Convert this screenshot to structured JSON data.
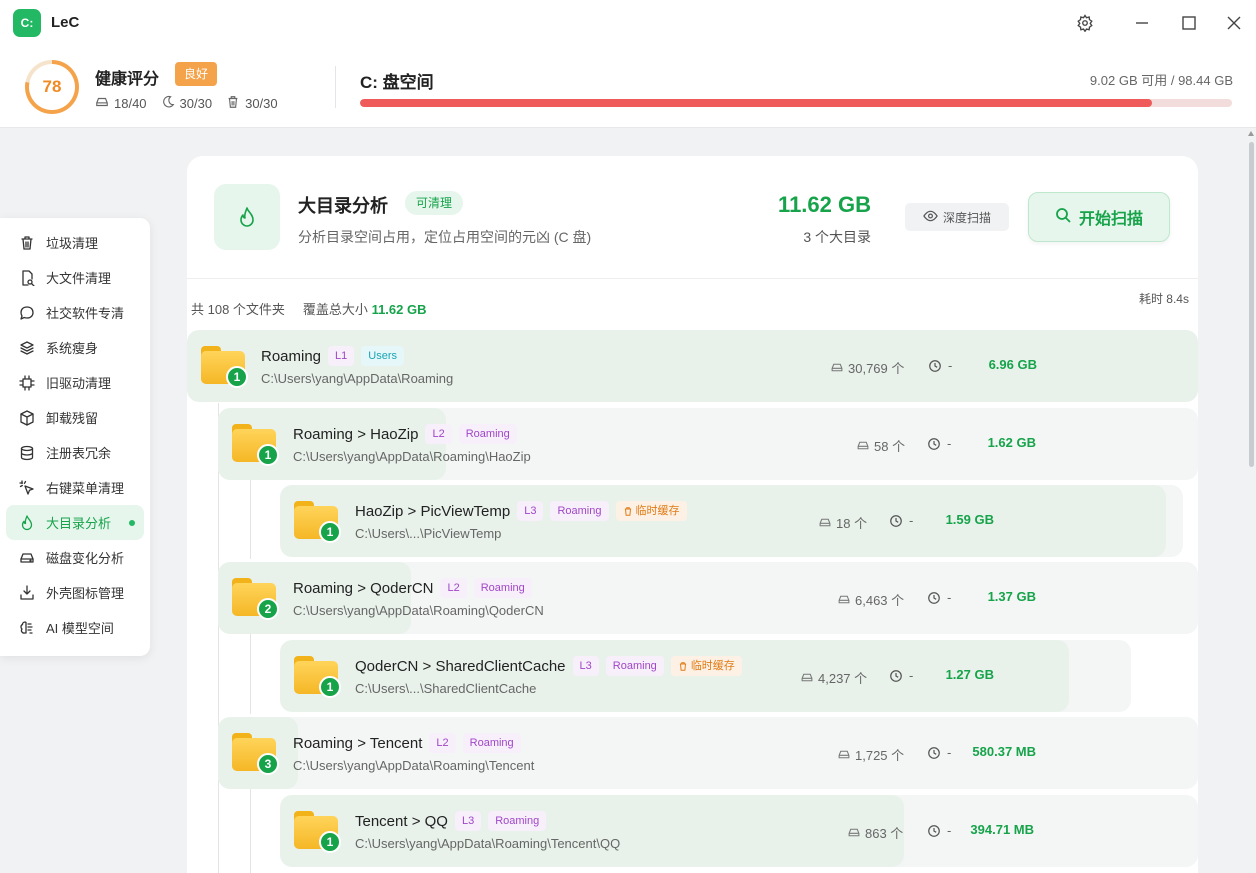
{
  "app": {
    "logo_text": "C:",
    "title": "LeC"
  },
  "window": {
    "settings_icon": "gear-icon",
    "minimize_icon": "minimize-icon",
    "maximize_icon": "maximize-icon",
    "close_icon": "close-icon"
  },
  "header": {
    "score": "78",
    "score_fraction": 0.78,
    "health_title": "健康评分",
    "health_badge": "良好",
    "stats": [
      {
        "icon": "drive-icon",
        "value": "18/40"
      },
      {
        "icon": "moon-icon",
        "value": "30/30"
      },
      {
        "icon": "trash-icon",
        "value": "30/30"
      }
    ],
    "disk_title": "C: 盘空间",
    "disk_usage": "9.02 GB 可用 / 98.44 GB",
    "disk_used_fraction": 0.908
  },
  "sidebar": {
    "items": [
      {
        "label": "垃圾清理",
        "icon": "trash-icon"
      },
      {
        "label": "大文件清理",
        "icon": "file-search-icon"
      },
      {
        "label": "社交软件专清",
        "icon": "chat-bubble-icon"
      },
      {
        "label": "系统瘦身",
        "icon": "layers-icon"
      },
      {
        "label": "旧驱动清理",
        "icon": "chip-icon"
      },
      {
        "label": "卸载残留",
        "icon": "package-icon"
      },
      {
        "label": "注册表冗余",
        "icon": "database-icon"
      },
      {
        "label": "右键菜单清理",
        "icon": "pointer-click-icon"
      },
      {
        "label": "大目录分析",
        "icon": "flame-icon",
        "active": true
      },
      {
        "label": "磁盘变化分析",
        "icon": "drive-icon"
      },
      {
        "label": "外壳图标管理",
        "icon": "download-tray-icon"
      },
      {
        "label": "AI 模型空间",
        "icon": "brain-icon"
      }
    ]
  },
  "section": {
    "icon": "flame-icon",
    "title": "大目录分析",
    "badge": "可清理",
    "description": "分析目录空间占用，定位占用空间的元凶 (C 盘)",
    "total_size": "11.62 GB",
    "total_count": "3 个大目录",
    "deep_scan_label": "深度扫描",
    "scan_label": "开始扫描",
    "summary_folders": "共 108 个文件夹",
    "summary_cover_label": "覆盖总大小",
    "summary_cover_value": "11.62 GB",
    "elapsed": "耗时 8.4s"
  },
  "rows": [
    {
      "rank": "1",
      "name": "Roaming",
      "level": "L1",
      "parent": "Users",
      "parent_style": "usr",
      "temp": "",
      "path": "C:\\Users\\yang\\AppData\\Roaming",
      "count": "30,769 个",
      "time": "-",
      "size": "6.96 GB",
      "share": 1.0
    },
    {
      "rank": "1",
      "name": "Roaming > HaoZip",
      "level": "L2",
      "parent": "Roaming",
      "parent_style": "pc",
      "temp": "",
      "path": "C:\\Users\\yang\\AppData\\Roaming\\HaoZip",
      "count": "58 个",
      "time": "-",
      "size": "1.62 GB",
      "share": 0.233
    },
    {
      "rank": "1",
      "name": "HaoZip > PicViewTemp",
      "level": "L3",
      "parent": "Roaming",
      "parent_style": "pc",
      "temp": "临时缓存",
      "path": "C:\\Users\\...\\PicViewTemp",
      "count": "18 个",
      "time": "-",
      "size": "1.59 GB",
      "share": 0.981
    },
    {
      "rank": "2",
      "name": "Roaming > QoderCN",
      "level": "L2",
      "parent": "Roaming",
      "parent_style": "pc",
      "temp": "",
      "path": "C:\\Users\\yang\\AppData\\Roaming\\QoderCN",
      "count": "6,463 个",
      "time": "-",
      "size": "1.37 GB",
      "share": 0.197
    },
    {
      "rank": "1",
      "name": "QoderCN > SharedClientCache",
      "level": "L3",
      "parent": "Roaming",
      "parent_style": "pc",
      "temp": "临时缓存",
      "path": "C:\\Users\\...\\SharedClientCache",
      "count": "4,237 个",
      "time": "-",
      "size": "1.27 GB",
      "share": 0.927
    },
    {
      "rank": "3",
      "name": "Roaming > Tencent",
      "level": "L2",
      "parent": "Roaming",
      "parent_style": "pc",
      "temp": "",
      "path": "C:\\Users\\yang\\AppData\\Roaming\\Tencent",
      "count": "1,725 个",
      "time": "-",
      "size": "580.37 MB",
      "share": 0.081
    },
    {
      "rank": "1",
      "name": "Tencent > QQ",
      "level": "L3",
      "parent": "Roaming",
      "parent_style": "pc",
      "temp": "",
      "path": "C:\\Users\\yang\\AppData\\Roaming\\Tencent\\QQ",
      "count": "863 个",
      "time": "-",
      "size": "394.71 MB",
      "share": 0.68
    }
  ],
  "colors": {
    "accent": "#16a34a",
    "warning": "#f5a34a",
    "danger": "#ef5b5b",
    "folder": "#f5b726"
  }
}
